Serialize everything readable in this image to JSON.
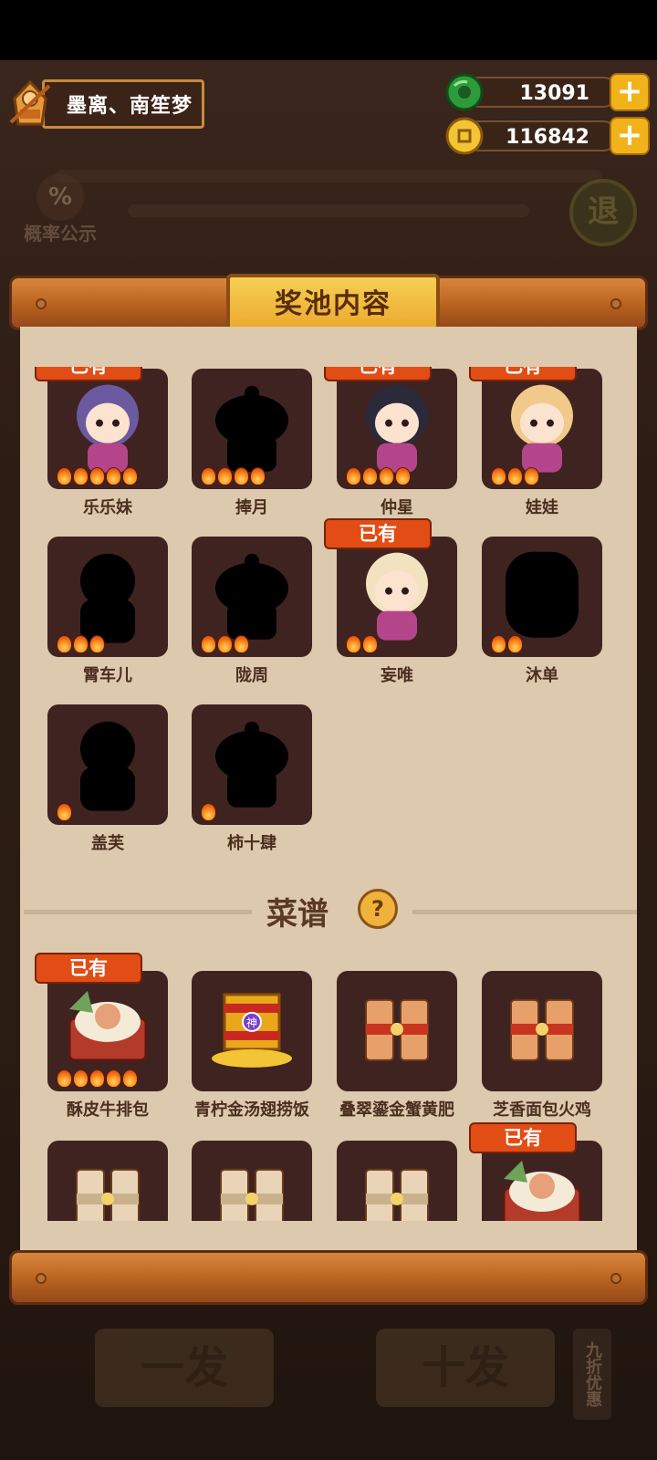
{
  "player": {
    "name": "墨离、南笙梦"
  },
  "currencies": [
    {
      "id": "jade",
      "amount": "13091",
      "icon": "jade-coin-icon",
      "plus": "+"
    },
    {
      "id": "gold",
      "amount": "116842",
      "icon": "gold-coin-icon",
      "plus": "+"
    }
  ],
  "probability": {
    "icon": "%",
    "label": "概率公示"
  },
  "exit": {
    "label": "退"
  },
  "panel": {
    "title": "奖池内容",
    "owned_label": "已有",
    "characters": [
      {
        "name": "乐乐妹",
        "stars": 5,
        "owned": true,
        "revealed": true,
        "color": "#6b5aa0"
      },
      {
        "name": "捧月",
        "stars": 4,
        "owned": false,
        "revealed": false
      },
      {
        "name": "仲星",
        "stars": 4,
        "owned": true,
        "revealed": true,
        "color": "#2a2a3a"
      },
      {
        "name": "娃娃",
        "stars": 3,
        "owned": true,
        "revealed": true,
        "color": "#f1c98a"
      },
      {
        "name": "霄车儿",
        "stars": 3,
        "owned": false,
        "revealed": false
      },
      {
        "name": "陇周",
        "stars": 3,
        "owned": false,
        "revealed": false
      },
      {
        "name": "妄唯",
        "stars": 2,
        "owned": true,
        "revealed": true,
        "color": "#f3e2c0"
      },
      {
        "name": "沐单",
        "stars": 2,
        "owned": false,
        "revealed": false
      },
      {
        "name": "盖芙",
        "stars": 1,
        "owned": false,
        "revealed": false
      },
      {
        "name": "柿十肆",
        "stars": 1,
        "owned": false,
        "revealed": false
      }
    ],
    "recipe_section": {
      "title": "菜谱",
      "help_icon": "?"
    },
    "recipes": [
      {
        "name": "酥皮牛排包",
        "stars": 5,
        "owned": true,
        "type": "dish"
      },
      {
        "name": "青柠金汤翅捞饭",
        "stars": 0,
        "owned": false,
        "type": "gold-box",
        "badge": "神"
      },
      {
        "name": "叠翠鎏金蟹黄肥",
        "stars": 0,
        "owned": false,
        "type": "red-box"
      },
      {
        "name": "芝香面包火鸡",
        "stars": 0,
        "owned": false,
        "type": "red-box"
      },
      {
        "name": "",
        "stars": 0,
        "owned": false,
        "type": "plain-box"
      },
      {
        "name": "",
        "stars": 0,
        "owned": false,
        "type": "plain-box"
      },
      {
        "name": "",
        "stars": 0,
        "owned": false,
        "type": "plain-box"
      },
      {
        "name": "",
        "stars": 0,
        "owned": true,
        "type": "dish2"
      }
    ]
  },
  "bottom": {
    "single": "一发",
    "ten": "十发",
    "discount": "九折优惠"
  },
  "colors": {
    "accent": "#e24d15",
    "panel": "#ddc9ae",
    "card": "#3f2321",
    "gold": "#f2b31a"
  }
}
